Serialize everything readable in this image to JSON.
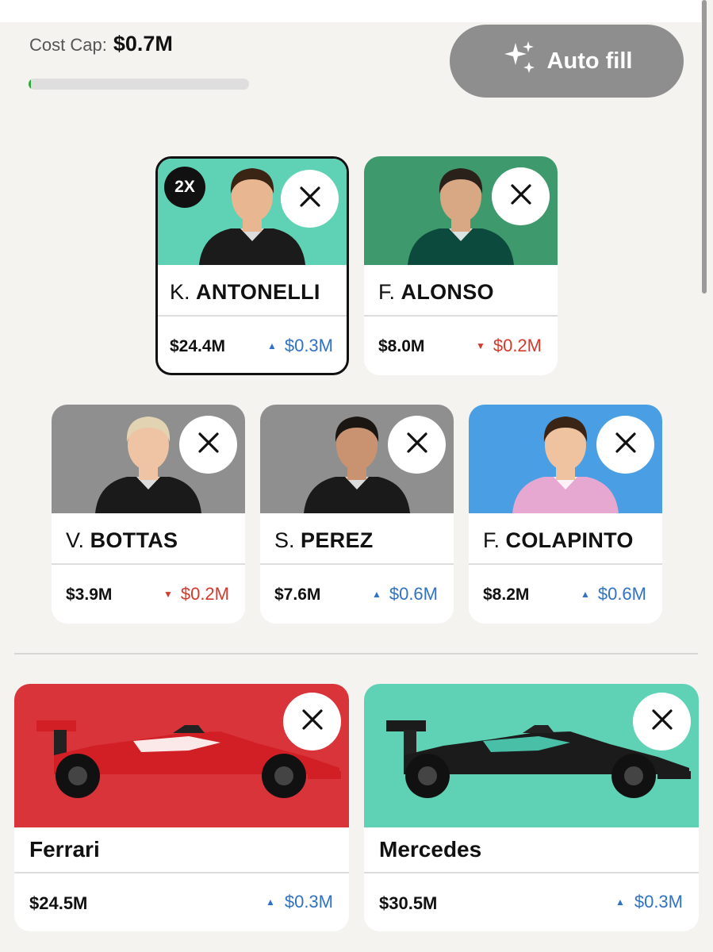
{
  "header": {
    "cost_cap_label": "Cost Cap:",
    "cost_cap_value": "$0.7M",
    "cost_cap_progress_percent": 1,
    "auto_fill_label": "Auto fill"
  },
  "drivers": [
    {
      "initial": "K.",
      "last": "ANTONELLI",
      "price": "$24.4M",
      "change": "$0.3M",
      "direction": "up",
      "bg": "#5fd1b5",
      "badge": "2X",
      "suit": "#1b1b1b",
      "hair": "#3a2414",
      "skin": "#e8b792"
    },
    {
      "initial": "F.",
      "last": "ALONSO",
      "price": "$8.0M",
      "change": "$0.2M",
      "direction": "down",
      "bg": "#3e9a6c",
      "suit": "#0d4a3e",
      "hair": "#2a211a",
      "skin": "#d8a884"
    },
    {
      "initial": "V.",
      "last": "BOTTAS",
      "price": "$3.9M",
      "change": "$0.2M",
      "direction": "down",
      "bg": "#8f8f8f",
      "suit": "#1a1a1a",
      "hair": "#e2d3b3",
      "skin": "#efc4a5"
    },
    {
      "initial": "S.",
      "last": "PEREZ",
      "price": "$7.6M",
      "change": "$0.6M",
      "direction": "up",
      "bg": "#8f8f8f",
      "suit": "#1a1a1a",
      "hair": "#1c1612",
      "skin": "#c99372"
    },
    {
      "initial": "F.",
      "last": "COLAPINTO",
      "price": "$8.2M",
      "change": "$0.6M",
      "direction": "up",
      "bg": "#4a9fe4",
      "suit": "#e6a8d0",
      "hair": "#3a2416",
      "skin": "#efc2a0"
    }
  ],
  "teams": [
    {
      "name": "Ferrari",
      "price": "$24.5M",
      "change": "$0.3M",
      "direction": "up",
      "bg": "#d9343a",
      "car_body": "#d21f26",
      "car_accent": "#ffffff"
    },
    {
      "name": "Mercedes",
      "price": "$30.5M",
      "change": "$0.3M",
      "direction": "up",
      "bg": "#5fd1b5",
      "car_body": "#1b1b1b",
      "car_accent": "#4fd1b8"
    }
  ],
  "icons": {
    "close": "close-icon",
    "sparkle": "sparkle-icon",
    "arrow_up": "arrow-up-icon",
    "arrow_down": "arrow-down-icon"
  }
}
